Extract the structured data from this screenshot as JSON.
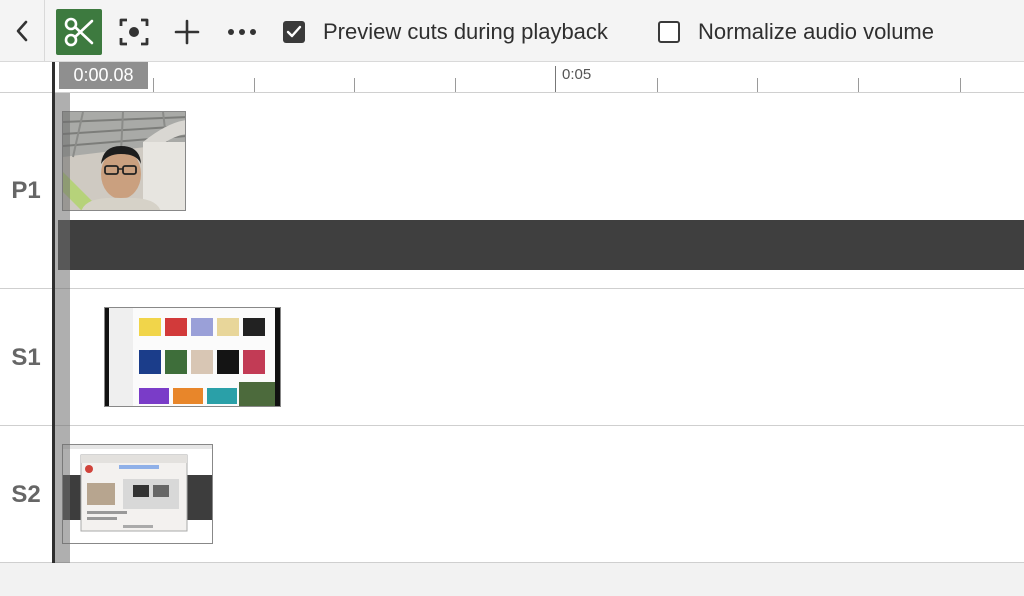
{
  "toolbar": {
    "back_icon": "chevron-left-icon",
    "split_icon": "scissors-icon",
    "focus_icon": "focus-target-icon",
    "add_icon": "plus-icon",
    "more_icon": "ellipsis-icon",
    "split_active_color": "#3d7a3f",
    "preview_cuts": {
      "label": "Preview cuts during playback",
      "checked": true
    },
    "normalize_audio": {
      "label": "Normalize audio volume",
      "checked": false
    }
  },
  "ruler": {
    "playhead_time": "0:00.08",
    "labels": [
      "0:05"
    ]
  },
  "tracks": [
    {
      "label": "P1",
      "clip": "camera-clip"
    },
    {
      "label": "S1",
      "clip": "screen-grid-clip"
    },
    {
      "label": "S2",
      "clip": "screen-recording-clip"
    }
  ]
}
